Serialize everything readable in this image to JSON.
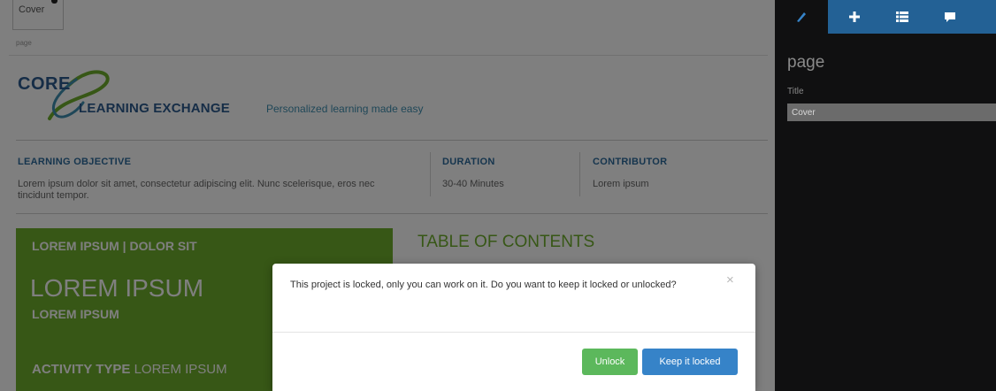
{
  "tab": {
    "label": "Cover"
  },
  "page_tag": "page",
  "header": {
    "logo_core": "CORE",
    "logo_learning": "LEARNING EXCHANGE",
    "logo_tagline": "Personalized learning made easy"
  },
  "meta": {
    "objective_title": "LEARNING OBJECTIVE",
    "objective_text": "Lorem ipsum dolor sit amet, consectetur adipiscing elit. Nunc scelerisque, eros nec tincidunt tempor.",
    "duration_title": "DURATION",
    "duration_text": "30-40 Minutes",
    "contributor_title": "CONTRIBUTOR",
    "contributor_text": "Lorem ipsum"
  },
  "green_block": {
    "small": "LOREM IPSUM | DOLOR SIT",
    "big": "LOREM IPSUM",
    "sub": "LOREM IPSUM",
    "activity_label": "ACTIVITY TYPE",
    "activity_value": "LOREM IPSUM"
  },
  "toc_title": "TABLE OF CONTENTS",
  "panel": {
    "tabs": [
      "edit-icon",
      "plus-icon",
      "list-icon",
      "comment-icon"
    ],
    "title": "page",
    "field_label": "Title",
    "field_value": "Cover"
  },
  "modal": {
    "message": "This project is locked, only you can work on it. Do you want to keep it locked or unlocked?",
    "close": "×",
    "unlock_label": "Unlock",
    "keep_label": "Keep it locked"
  },
  "colors": {
    "green": "#6fae2d",
    "brand_blue": "#2c5b8e",
    "panel_bg": "#101011",
    "panel_tab": "#236195",
    "unlock": "#5cb85c",
    "keep": "#3683c8"
  }
}
